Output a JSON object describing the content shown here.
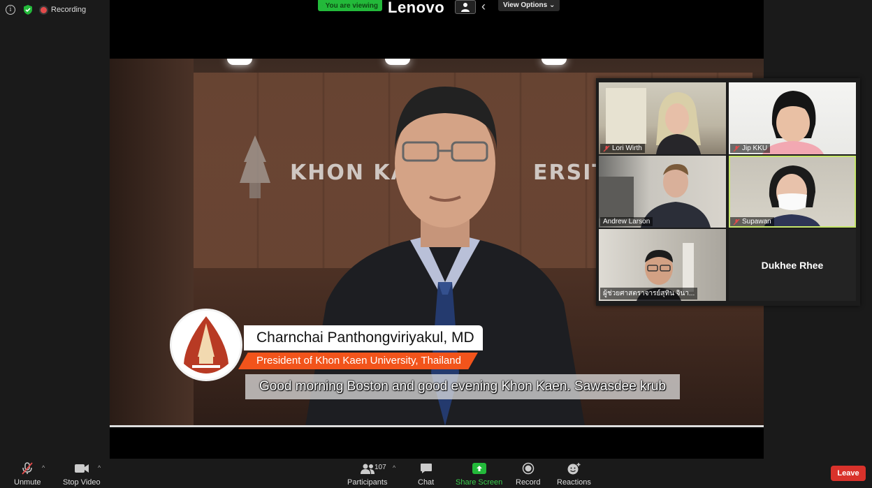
{
  "status": {
    "recording_label": "Recording"
  },
  "share_bar": {
    "viewing_text": "You are viewing",
    "brand": "Lenovo",
    "view_options": "View Options ⌄"
  },
  "video": {
    "sign_left": "KHON KA",
    "sign_right": "ERSITY",
    "speaker_name": "Charnchai  Panthongviriyakul, MD",
    "speaker_title": "President of Khon Kaen University, Thailand",
    "caption": "Good morning Boston and good evening Khon Kaen. Sawasdee krub"
  },
  "participants": [
    {
      "name": "Lori Wirth",
      "muted": true
    },
    {
      "name": "Jip KKU",
      "muted": true
    },
    {
      "name": "Andrew Larson",
      "muted": false
    },
    {
      "name": "Supawan",
      "muted": true,
      "active": true
    },
    {
      "name": "ผู้ช่วยศาสตราจารย์สุทิน จินา...",
      "muted": false
    },
    {
      "name": "Dukhee Rhee",
      "muted": false,
      "video_off": true
    }
  ],
  "toolbar": {
    "unmute": "Unmute",
    "stop_video": "Stop Video",
    "participants": "Participants",
    "participant_count": "107",
    "chat": "Chat",
    "share_screen": "Share Screen",
    "record": "Record",
    "reactions": "Reactions",
    "leave": "Leave"
  },
  "colors": {
    "accent_green": "#23b93a",
    "leave_red": "#d9322b",
    "title_orange": "#f2541b",
    "active_speaker": "#c6e66a"
  }
}
